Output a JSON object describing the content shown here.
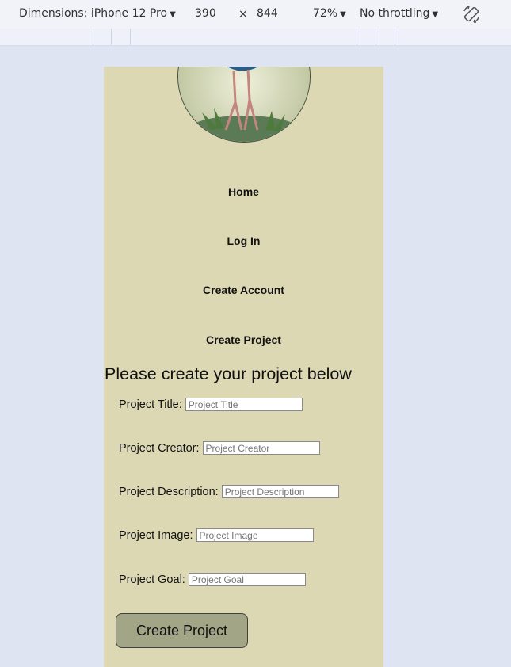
{
  "devtools": {
    "device_label": "Dimensions: iPhone 12 Pro",
    "width": "390",
    "times": "×",
    "height": "844",
    "zoom": "72%",
    "throttling": "No throttling",
    "dropdown_arrow": "▼",
    "rotate_icon": "rotate-icon"
  },
  "nav": {
    "items": [
      {
        "label": "Home"
      },
      {
        "label": "Log In"
      },
      {
        "label": "Create Account"
      },
      {
        "label": "Create Project"
      }
    ]
  },
  "form": {
    "heading": "Please create your project below",
    "fields": [
      {
        "label": "Project Title:",
        "placeholder": "Project Title"
      },
      {
        "label": "Project Creator:",
        "placeholder": "Project Creator"
      },
      {
        "label": "Project Description:",
        "placeholder": "Project Description"
      },
      {
        "label": "Project Image:",
        "placeholder": "Project Image"
      },
      {
        "label": "Project Goal:",
        "placeholder": "Project Goal"
      }
    ],
    "submit_label": "Create Project"
  },
  "colors": {
    "page_background": "#dfe4f3",
    "viewport_background": "#dcd8b4",
    "button_background": "#a2a686"
  }
}
